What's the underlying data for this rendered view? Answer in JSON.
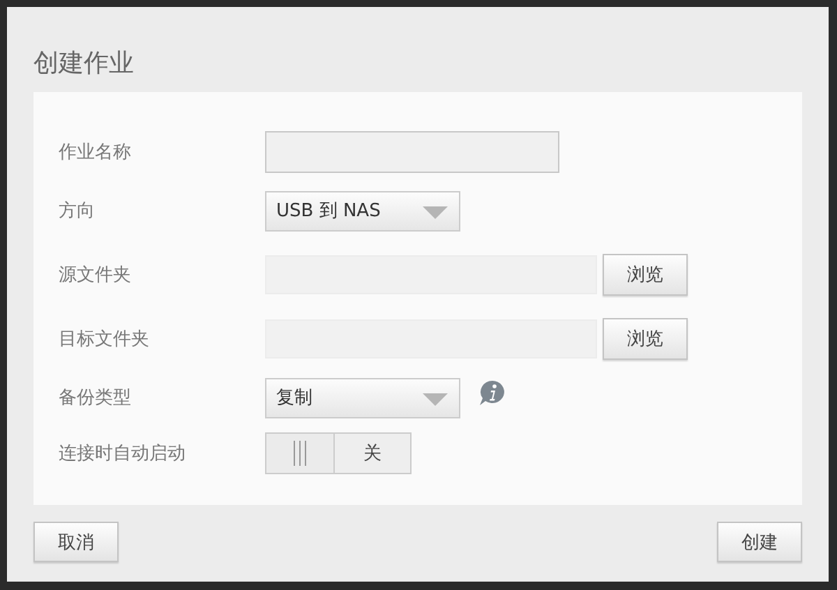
{
  "dialog": {
    "title": "创建作业"
  },
  "rows": [
    {
      "kind": "text",
      "label": "作业名称"
    },
    {
      "kind": "select",
      "label": "方向",
      "value": "USB 到 NAS",
      "info": false
    },
    {
      "kind": "folder",
      "label": "源文件夹",
      "button": "浏览"
    },
    {
      "kind": "folder",
      "label": "目标文件夹",
      "button": "浏览"
    },
    {
      "kind": "select",
      "label": "备份类型",
      "value": "复制",
      "info": true
    },
    {
      "kind": "toggle",
      "label": "连接时自动启动",
      "on": false,
      "state_label": "关"
    }
  ],
  "footer": {
    "cancel": "取消",
    "create": "创建"
  }
}
